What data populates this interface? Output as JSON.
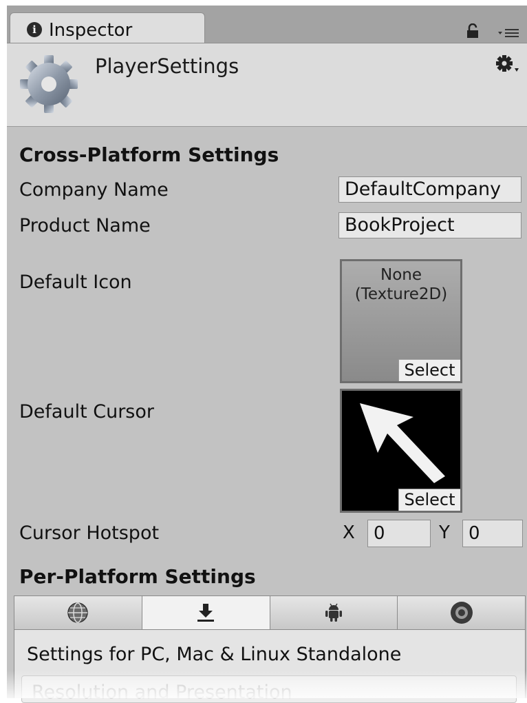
{
  "window": {
    "tab_label": "Inspector"
  },
  "header": {
    "title": "PlayerSettings"
  },
  "cross_platform": {
    "section_title": "Cross-Platform Settings",
    "company_name_label": "Company Name",
    "company_name_value": "DefaultCompany",
    "product_name_label": "Product Name",
    "product_name_value": "BookProject",
    "default_icon_label": "Default Icon",
    "default_icon_text_1": "None",
    "default_icon_text_2": "(Texture2D)",
    "default_icon_select": "Select",
    "default_cursor_label": "Default Cursor",
    "default_cursor_select": "Select",
    "cursor_hotspot_label": "Cursor Hotspot",
    "hotspot_x_label": "X",
    "hotspot_x_value": "0",
    "hotspot_y_label": "Y",
    "hotspot_y_value": "0"
  },
  "per_platform": {
    "section_title": "Per-Platform Settings",
    "tabs": [
      {
        "icon": "globe-icon",
        "active": false
      },
      {
        "icon": "download-icon",
        "active": true
      },
      {
        "icon": "android-icon",
        "active": false
      },
      {
        "icon": "console-disc-icon",
        "active": false
      }
    ],
    "panel_title": "Settings for PC, Mac & Linux Standalone",
    "foldout_label": "Resolution and Presentation"
  },
  "colors": {
    "tab_bar": "#a3a3a3",
    "content_bg": "#c2c2c2",
    "header_bg": "#dcdcdc"
  }
}
